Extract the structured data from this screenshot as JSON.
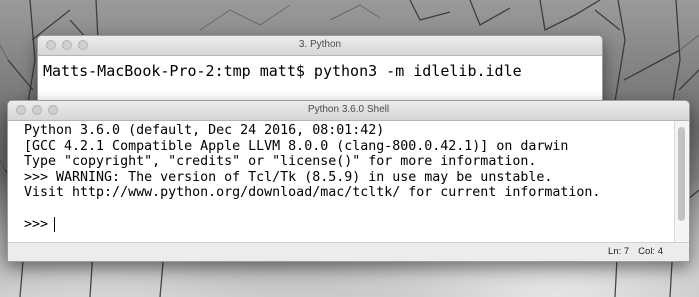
{
  "terminal": {
    "title": "3. Python",
    "command_line": "Matts-MacBook-Pro-2:tmp matt$ python3 -m idlelib.idle"
  },
  "idle_shell": {
    "title": "Python 3.6.0 Shell",
    "output_lines": [
      "Python 3.6.0 (default, Dec 24 2016, 08:01:42)",
      "[GCC 4.2.1 Compatible Apple LLVM 8.0.0 (clang-800.0.42.1)] on darwin",
      "Type \"copyright\", \"credits\" or \"license()\" for more information.",
      ">>> WARNING: The version of Tcl/Tk (8.5.9) in use may be unstable.",
      "Visit http://www.python.org/download/mac/tcltk/ for current information."
    ],
    "prompt": ">>>",
    "status": {
      "line": "Ln: 7",
      "col": "Col: 4"
    }
  },
  "icons": {
    "close": "close-button-icon",
    "minimize": "minimize-button-icon",
    "zoom": "zoom-button-icon"
  }
}
